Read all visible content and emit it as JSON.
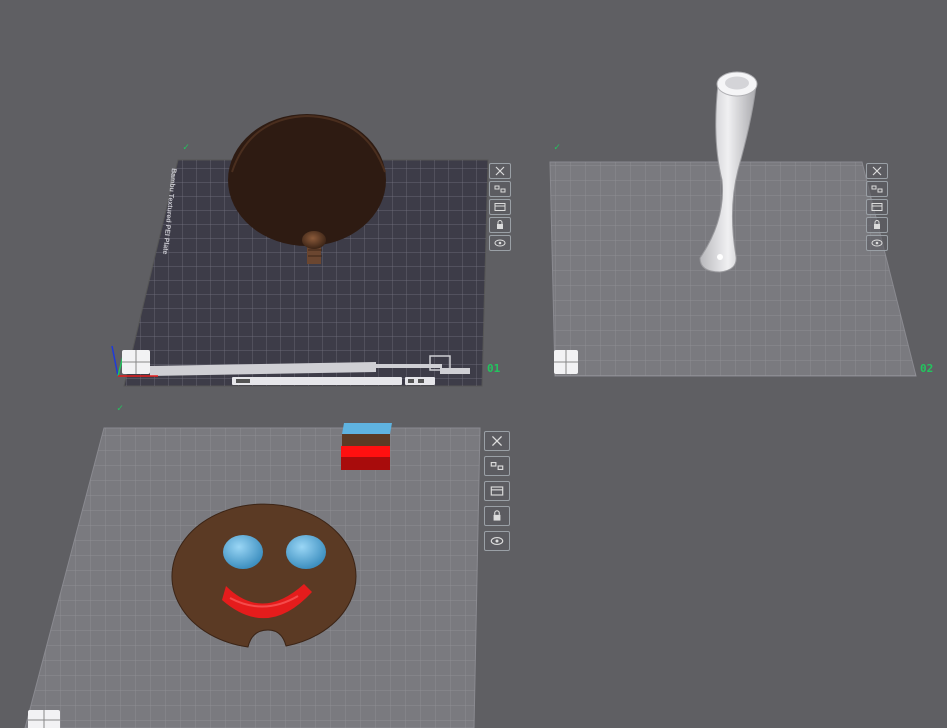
{
  "plates": [
    {
      "id": "plate-1",
      "label": "01",
      "corner": "✓",
      "type": "textured-dark",
      "logo_text": "Bambu Textured PEI Plate"
    },
    {
      "id": "plate-2",
      "label": "02",
      "corner": "✓",
      "type": "smooth-light"
    },
    {
      "id": "plate-3",
      "label": "",
      "corner": "✓",
      "type": "smooth-light"
    }
  ],
  "plate_toolbar_icons": [
    "close-icon",
    "auto-arrange-icon",
    "plate-settings-icon",
    "lock-icon",
    "orient-icon"
  ],
  "colors": {
    "background": "#5f5f63",
    "plate_light": "#7a7a7f",
    "plate_dark": "#3d3c48",
    "grid": "#9a9aa0",
    "label_green": "#22c55e",
    "brown_dark": "#2e1b12",
    "brown_smiley": "#5b3a24",
    "eye_blue": "#5fb3e0",
    "mouth_red": "#e51c1c",
    "vase_gray": "#d9d9dc"
  }
}
